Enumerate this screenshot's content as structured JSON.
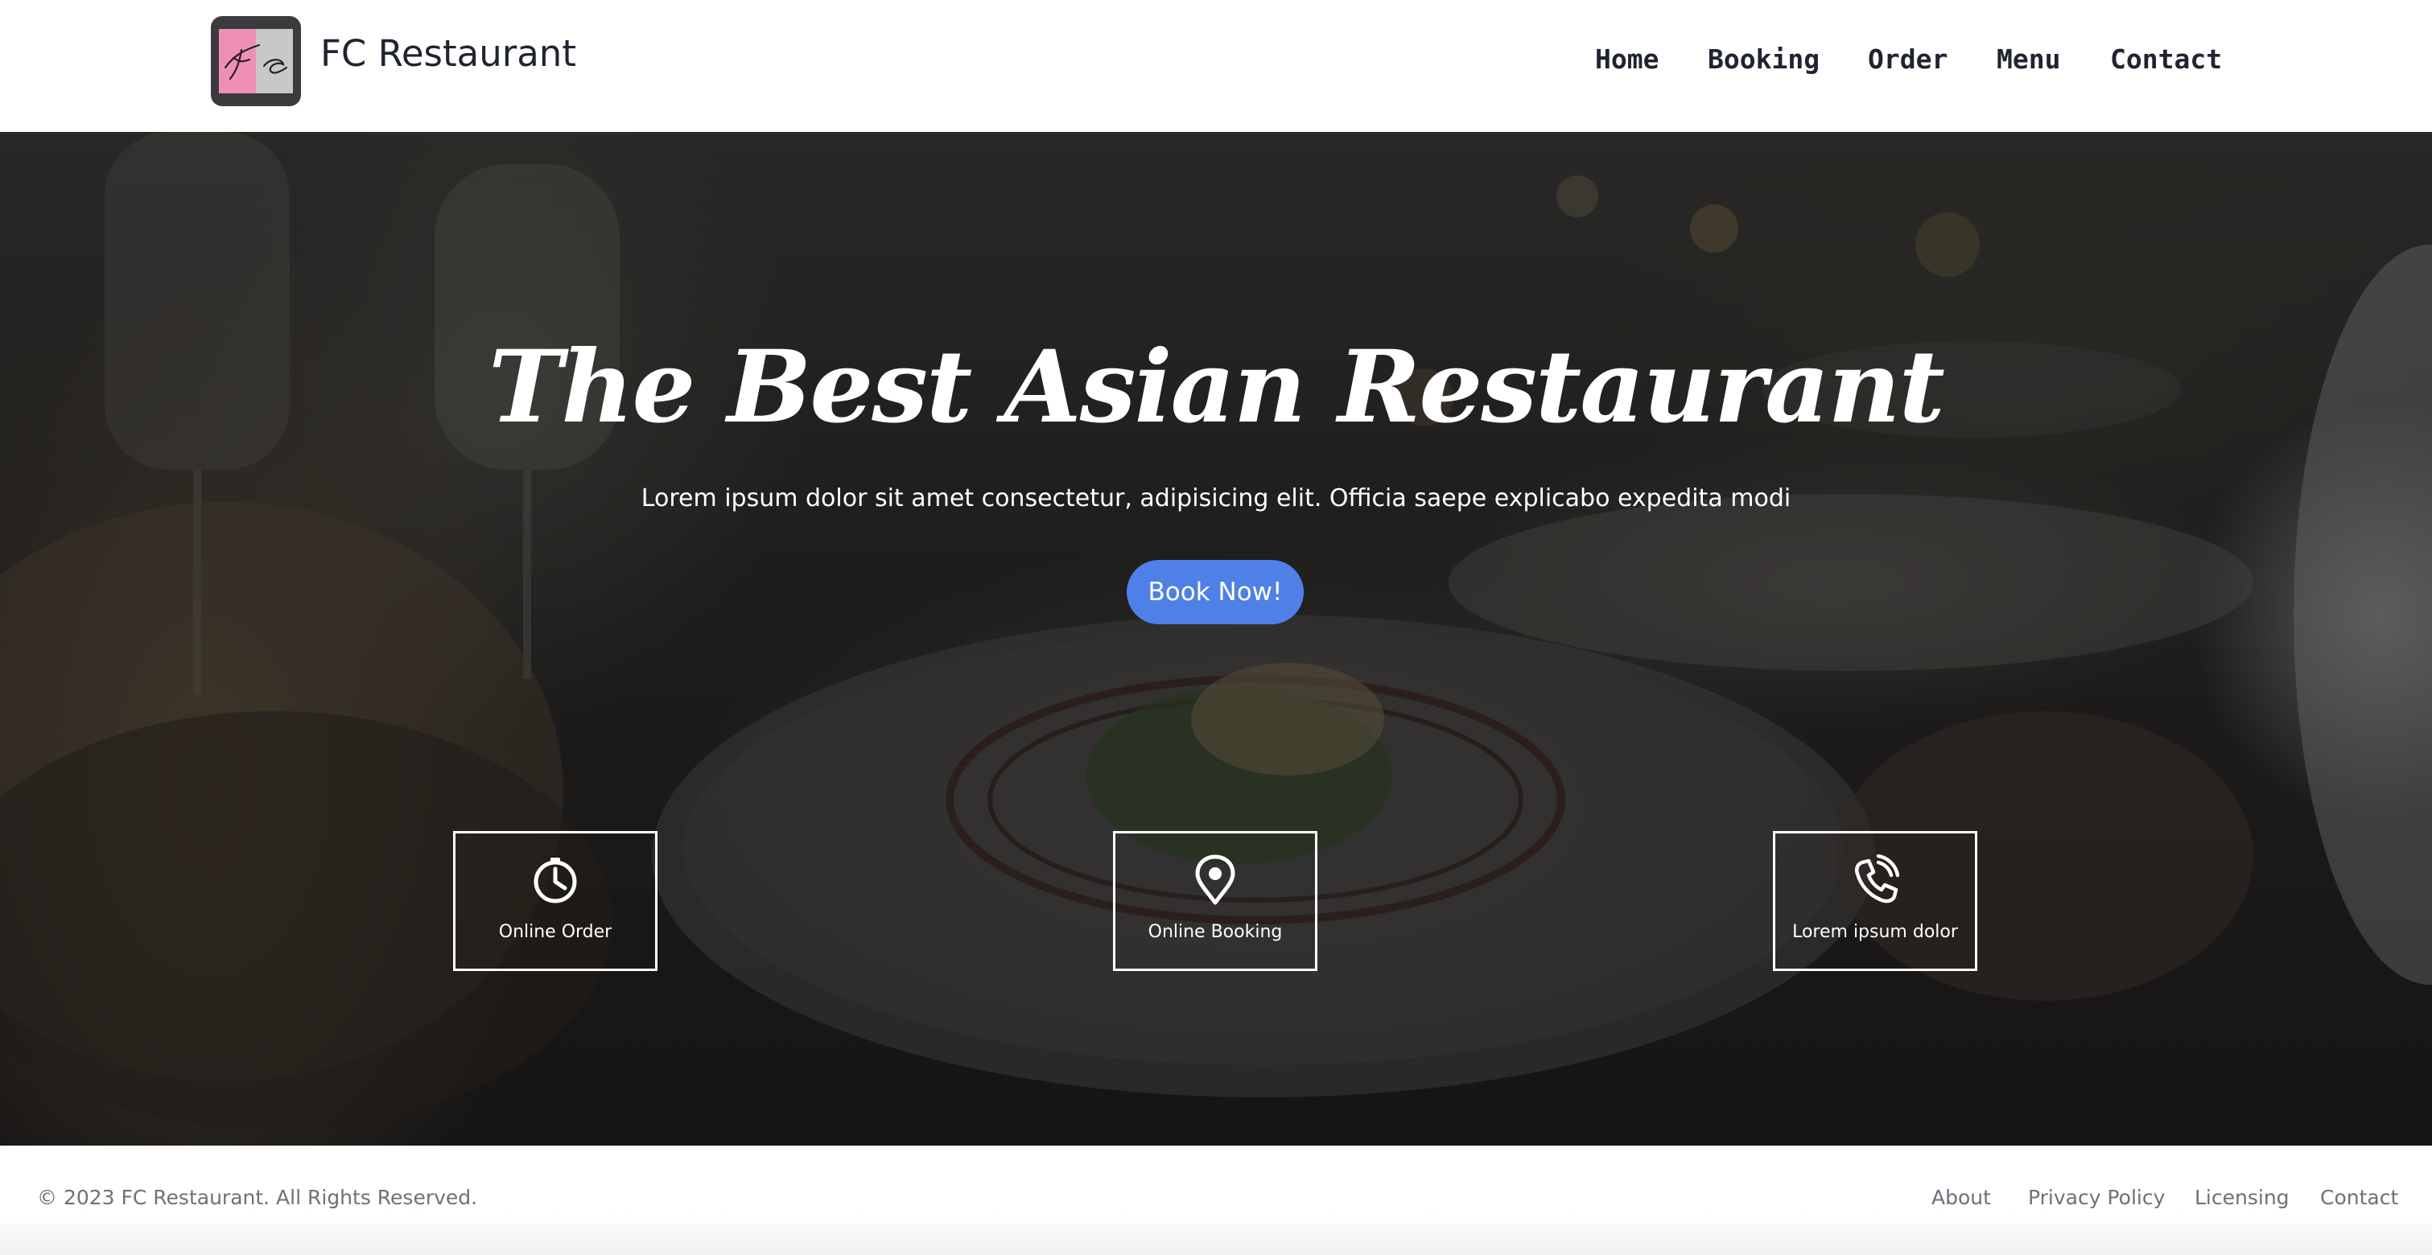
{
  "header": {
    "brand": "FC Restaurant",
    "logo_text": "Fc",
    "nav": [
      {
        "label": "Home"
      },
      {
        "label": "Booking"
      },
      {
        "label": "Order"
      },
      {
        "label": "Menu"
      },
      {
        "label": "Contact"
      }
    ]
  },
  "hero": {
    "title": "The Best Asian Restaurant",
    "subtitle": "Lorem ipsum dolor sit amet consectetur, adipisicing elit. Officia saepe explicabo expedita modi",
    "cta_label": "Book Now!",
    "features": [
      {
        "label": "Online Order",
        "icon": "clock-icon"
      },
      {
        "label": "Online Booking",
        "icon": "location-pin-icon"
      },
      {
        "label": "Lorem ipsum dolor",
        "icon": "phone-call-icon"
      }
    ]
  },
  "footer": {
    "copyright": "© 2023 FC Restaurant. All Rights Reserved.",
    "links": [
      {
        "label": "About"
      },
      {
        "label": "Privacy Policy"
      },
      {
        "label": "Licensing"
      },
      {
        "label": "Contact"
      }
    ]
  },
  "colors": {
    "accent": "#4f80e7",
    "text_dark": "#1f2430",
    "footer_text": "#6c717a",
    "logo_pink": "#f08fb6",
    "logo_bg": "#3b3b3d"
  }
}
